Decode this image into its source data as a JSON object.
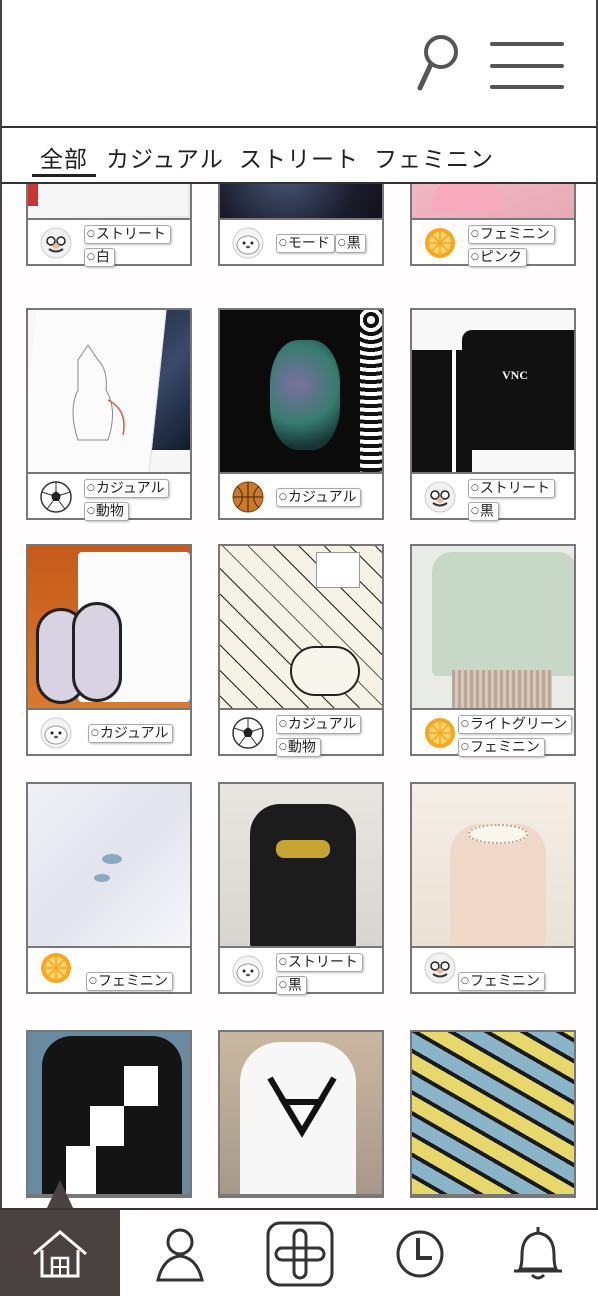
{
  "header": {
    "search_icon": "search-icon",
    "menu_icon": "hamburger-menu-icon"
  },
  "tabs": [
    {
      "label": "全部",
      "active": true
    },
    {
      "label": "カジュアル",
      "active": false
    },
    {
      "label": "ストリート",
      "active": false
    },
    {
      "label": "フェミニン",
      "active": false
    }
  ],
  "rows": [
    [
      {
        "avatar": "disguise-glasses-icon",
        "tags": [
          "ストリート",
          "白"
        ]
      },
      {
        "avatar": "seal-icon",
        "tags": [
          "モード",
          "黒"
        ]
      },
      {
        "avatar": "orange-slice-icon",
        "tags": [
          "フェミニン",
          "ピンク"
        ]
      }
    ],
    [
      {
        "avatar": "soccer-ball-icon",
        "tags": [
          "カジュアル",
          "動物"
        ]
      },
      {
        "avatar": "basketball-icon",
        "tags": [
          "カジュアル"
        ]
      },
      {
        "avatar": "disguise-glasses-icon",
        "tags": [
          "ストリート",
          "黒"
        ]
      }
    ],
    [
      {
        "avatar": "seal-icon",
        "tags": [
          "カジュアル"
        ]
      },
      {
        "avatar": "soccer-ball-icon",
        "tags": [
          "カジュアル",
          "動物"
        ]
      },
      {
        "avatar": "orange-slice-icon",
        "tags": [
          "ライトグリーン",
          "フェミニン"
        ]
      }
    ],
    [
      {
        "avatar": "orange-slice-icon",
        "tags": [
          "フェミニン"
        ]
      },
      {
        "avatar": "seal-icon",
        "tags": [
          "ストリート",
          "黒"
        ]
      },
      {
        "avatar": "disguise-glasses-icon",
        "tags": [
          "フェミニン"
        ]
      }
    ],
    [
      {
        "avatar": "",
        "tags": []
      },
      {
        "avatar": "",
        "tags": []
      },
      {
        "avatar": "",
        "tags": []
      }
    ]
  ],
  "bottom_nav": [
    {
      "icon": "home-icon",
      "active": true
    },
    {
      "icon": "user-icon",
      "active": false
    },
    {
      "icon": "add-post-icon",
      "active": false
    },
    {
      "icon": "clock-icon",
      "active": false
    },
    {
      "icon": "bell-icon",
      "active": false
    }
  ],
  "colors": {
    "active_nav_bg": "#4a4240",
    "border": "#777777",
    "text": "#222222"
  }
}
